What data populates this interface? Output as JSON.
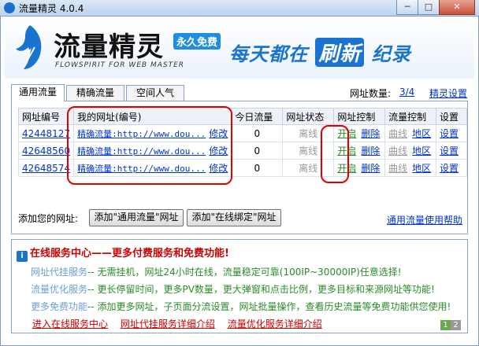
{
  "window": {
    "title": "流量精灵 4.0.4",
    "controls": [
      "─",
      "□",
      "✕"
    ]
  },
  "banner": {
    "logo_text": "流量精灵",
    "logo_badge": "永久免费",
    "logo_sub": "FLOWSPIRIT FOR WEB MASTER",
    "slogan_a": "每天都在",
    "slogan_b": "刷新",
    "slogan_c": "纪录"
  },
  "tabs": [
    "通用流量",
    "精确流量",
    "空间人气"
  ],
  "top": {
    "count_label": "网址数量:",
    "count_value": "3/4",
    "settings_link": "精灵设置"
  },
  "table": {
    "headers": [
      "网址编号",
      "我的网址(编号)",
      "今日流量",
      "网址状态",
      "网址控制",
      "流量控制",
      "设置"
    ],
    "rows": [
      {
        "id": "42448127",
        "name": "精确流量:http://www.dou...",
        "edit": "修改",
        "today": "0",
        "status": "离线",
        "open": "开启",
        "del": "删除",
        "curve": "曲线",
        "region": "地区",
        "set": "设置"
      },
      {
        "id": "42648560",
        "name": "精确流量:http://www.dou...",
        "edit": "修改",
        "today": "0",
        "status": "离线",
        "open": "开启",
        "del": "删除",
        "curve": "曲线",
        "region": "地区",
        "set": "设置"
      },
      {
        "id": "42648574",
        "name": "精确流量:http://www.dou...",
        "edit": "修改",
        "today": "0",
        "status": "离线",
        "open": "开启",
        "del": "删除",
        "curve": "曲线",
        "region": "地区",
        "set": "设置"
      }
    ]
  },
  "add": {
    "label": "添加您的网址:",
    "btn_general": "添加\"通用流量\"网址",
    "btn_online": "添加\"在线绑定\"网址",
    "help_link": "通用流量使用帮助"
  },
  "service": {
    "icon": "i",
    "heading": "在线服务中心——更多付费服务和免费功能!",
    "lines": [
      {
        "k": "网址代挂服务",
        "v": "-- 无需挂机，网址24小时在线，流量稳定可靠(100IP~30000IP)任意选择!"
      },
      {
        "k": "流量优化服务",
        "v": "-- 更长停留时间，更多PV数量，更大弹窗和点击比例，更多目标和来源网址等功能!"
      },
      {
        "k": "更多免费功能",
        "v": "-- 添加更多网址，子页面分流设置，网址批量操作，查看历史流量等免费功能供您使用!"
      }
    ],
    "links": [
      "进入在线服务中心",
      "网址代挂服务详细介绍",
      "流量优化服务详细介绍"
    ],
    "pages": [
      "1",
      "2"
    ]
  },
  "colors": {
    "accent": "#1a73d1",
    "link": "#0033cc",
    "open_green": "#2a8a2a",
    "service_red": "#cc0000",
    "annotation_red": "#e00000"
  }
}
